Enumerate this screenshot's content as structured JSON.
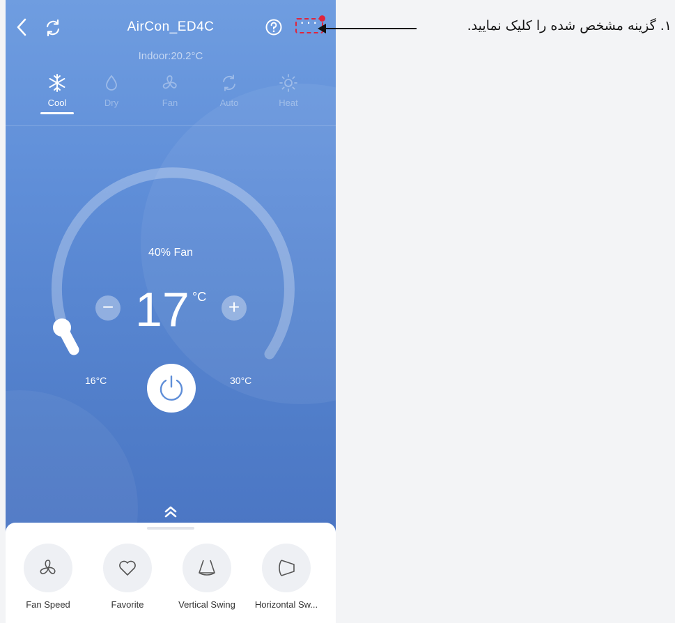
{
  "header": {
    "title": "AirCon_ED4C",
    "indoor": "Indoor:20.2°C",
    "more_dots": "···"
  },
  "modes": [
    {
      "label": "Cool",
      "icon": "snowflake-icon",
      "active": true
    },
    {
      "label": "Dry",
      "icon": "droplet-icon",
      "active": false
    },
    {
      "label": "Fan",
      "icon": "fan-icon",
      "active": false
    },
    {
      "label": "Auto",
      "icon": "auto-cycle-icon",
      "active": false
    },
    {
      "label": "Heat",
      "icon": "sun-icon",
      "active": false
    }
  ],
  "dial": {
    "fan_level": "40% Fan",
    "temperature": "17",
    "unit": "°C",
    "minus": "−",
    "plus": "+",
    "min_label": "16°C",
    "max_label": "30°C",
    "range": [
      16,
      30
    ]
  },
  "functions": [
    {
      "label": "Fan Speed",
      "icon": "fan-speed-icon"
    },
    {
      "label": "Favorite",
      "icon": "heart-icon"
    },
    {
      "label": "Vertical Swing",
      "icon": "vertical-swing-icon"
    },
    {
      "label": "Horizontal Sw...",
      "icon": "horizontal-swing-icon"
    }
  ],
  "annotation": {
    "text": "۱. گزینه مشخص شده را کلیک نمایید."
  },
  "colors": {
    "accent_red": "#e0243b",
    "bg_blue": "#5f8ed8"
  }
}
